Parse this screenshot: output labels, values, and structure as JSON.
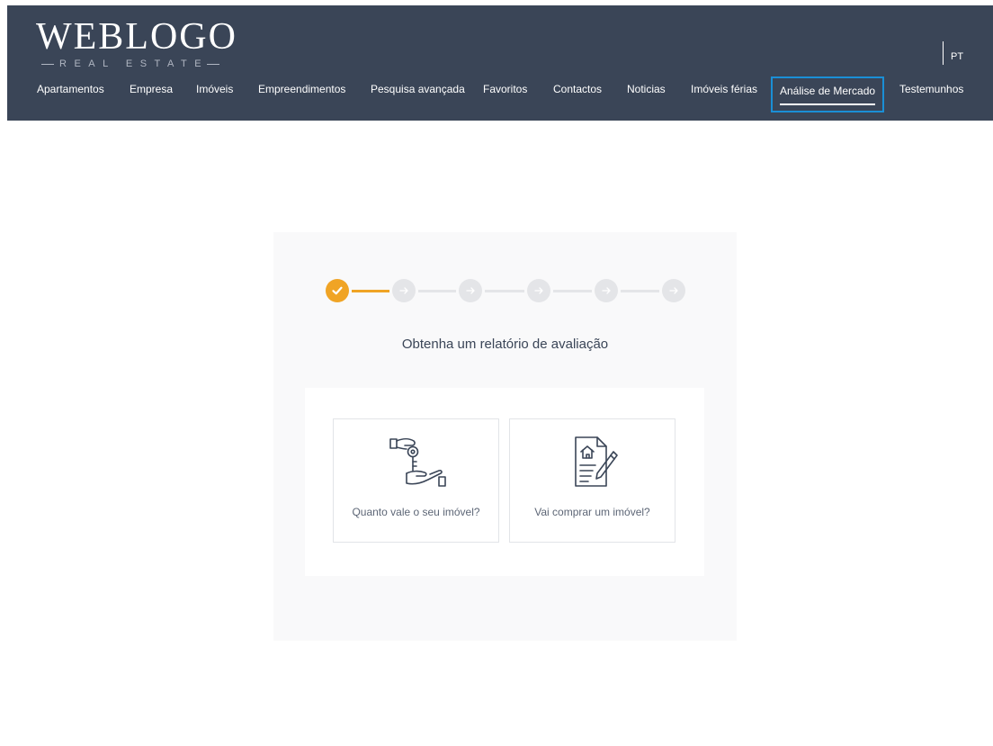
{
  "logo": {
    "main": "WEBLOGO",
    "sub": "REAL ESTATE"
  },
  "language": "PT",
  "nav": {
    "items": [
      {
        "label": "Apartamentos"
      },
      {
        "label": "Empresa"
      },
      {
        "label": "Imóveis"
      },
      {
        "label": "Empreendimentos"
      },
      {
        "label": "Pesquisa avançada"
      },
      {
        "label": "Favoritos"
      },
      {
        "label": "Contactos"
      },
      {
        "label": "Noticias"
      },
      {
        "label": "Imóveis férias"
      },
      {
        "label": "Análise de Mercado",
        "active": true
      },
      {
        "label": "Testemunhos"
      }
    ]
  },
  "stepper": {
    "total_steps": 6,
    "completed_steps": 1
  },
  "main": {
    "title": "Obtenha um relatório de avaliação",
    "options": [
      {
        "label": "Quanto vale o seu imóvel?",
        "icon": "hand-key-icon"
      },
      {
        "label": "Vai comprar um imóvel?",
        "icon": "house-contract-icon"
      }
    ]
  },
  "colors": {
    "header_bg": "#3a4557",
    "accent": "#f0a425",
    "active_border": "#1a8fd6",
    "step_inactive": "#e4e5e8",
    "panel_bg": "#f9f9fa"
  }
}
